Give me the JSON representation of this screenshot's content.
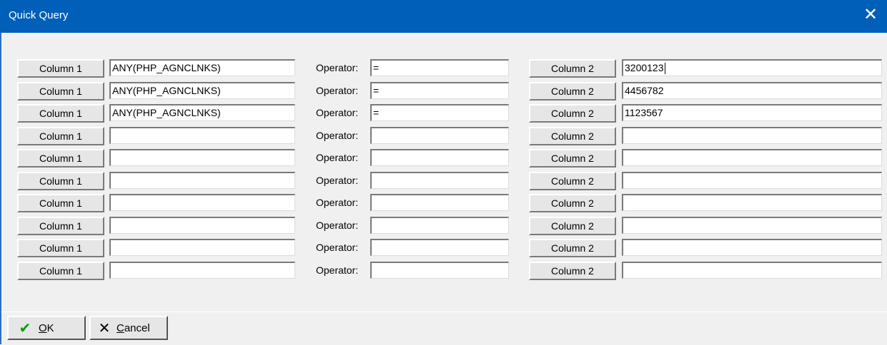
{
  "window": {
    "title": "Quick Query",
    "close_icon": "close-icon"
  },
  "operator_label": "Operator:",
  "rows": [
    {
      "col1": "Column 1",
      "value1": "ANY(PHP_AGNCLNKS)",
      "operator": "=",
      "col2": "Column 2",
      "value2": "3200123"
    },
    {
      "col1": "Column 1",
      "value1": "ANY(PHP_AGNCLNKS)",
      "operator": "=",
      "col2": "Column 2",
      "value2": "4456782"
    },
    {
      "col1": "Column 1",
      "value1": "ANY(PHP_AGNCLNKS)",
      "operator": "=",
      "col2": "Column 2",
      "value2": "1123567"
    },
    {
      "col1": "Column 1",
      "value1": "",
      "operator": "",
      "col2": "Column 2",
      "value2": ""
    },
    {
      "col1": "Column 1",
      "value1": "",
      "operator": "",
      "col2": "Column 2",
      "value2": ""
    },
    {
      "col1": "Column 1",
      "value1": "",
      "operator": "",
      "col2": "Column 2",
      "value2": ""
    },
    {
      "col1": "Column 1",
      "value1": "",
      "operator": "",
      "col2": "Column 2",
      "value2": ""
    },
    {
      "col1": "Column 1",
      "value1": "",
      "operator": "",
      "col2": "Column 2",
      "value2": ""
    },
    {
      "col1": "Column 1",
      "value1": "",
      "operator": "",
      "col2": "Column 2",
      "value2": ""
    },
    {
      "col1": "Column 1",
      "value1": "",
      "operator": "",
      "col2": "Column 2",
      "value2": ""
    }
  ],
  "footer": {
    "ok_label": "OK",
    "ok_mnemonic": "O",
    "ok_rest": "K",
    "cancel_mnemonic": "C",
    "cancel_rest": "ancel",
    "ok_icon": "checkmark-icon",
    "cancel_icon": "x-icon"
  }
}
